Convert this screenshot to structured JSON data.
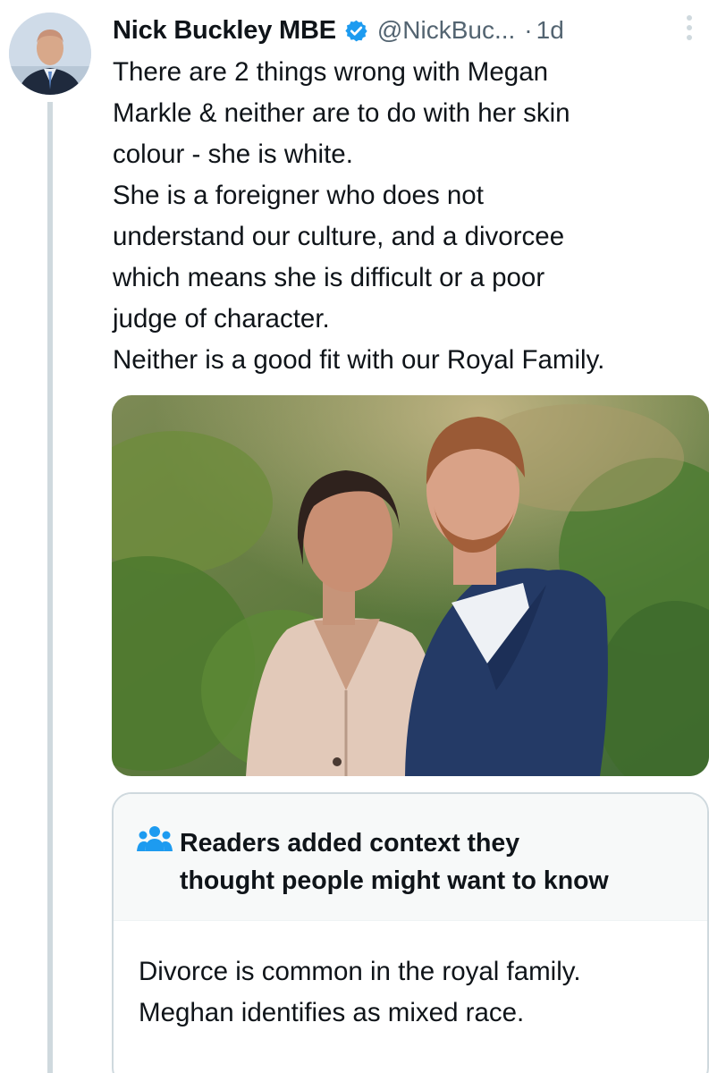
{
  "tweet": {
    "author": {
      "display_name": "Nick Buckley MBE",
      "handle": "@NickBuc...",
      "verified": true,
      "avatar_icon": "profile-photo"
    },
    "separator": "·",
    "time": "1d",
    "text_lines": [
      "There are 2 things wrong with Megan",
      "Markle & neither are to do with her skin",
      "colour - she is white.",
      "She is a foreigner who does not",
      "understand our culture, and a divorcee",
      "which means she is difficult or a poor",
      "judge of character.",
      "Neither is a good fit with our Royal Family."
    ],
    "media": {
      "type": "photo"
    }
  },
  "community_note": {
    "icon": "readers-icon",
    "title_lines": [
      "Readers added context they",
      "thought people might want to know"
    ],
    "body_lines": [
      "Divorce is common in the royal family.",
      "Meghan identifies as mixed race."
    ]
  },
  "colors": {
    "text_primary": "#0f1419",
    "text_secondary": "#536471",
    "verified_blue": "#1d9bf0",
    "readers_icon": "#1d9bf0",
    "border": "#cfd9de"
  }
}
